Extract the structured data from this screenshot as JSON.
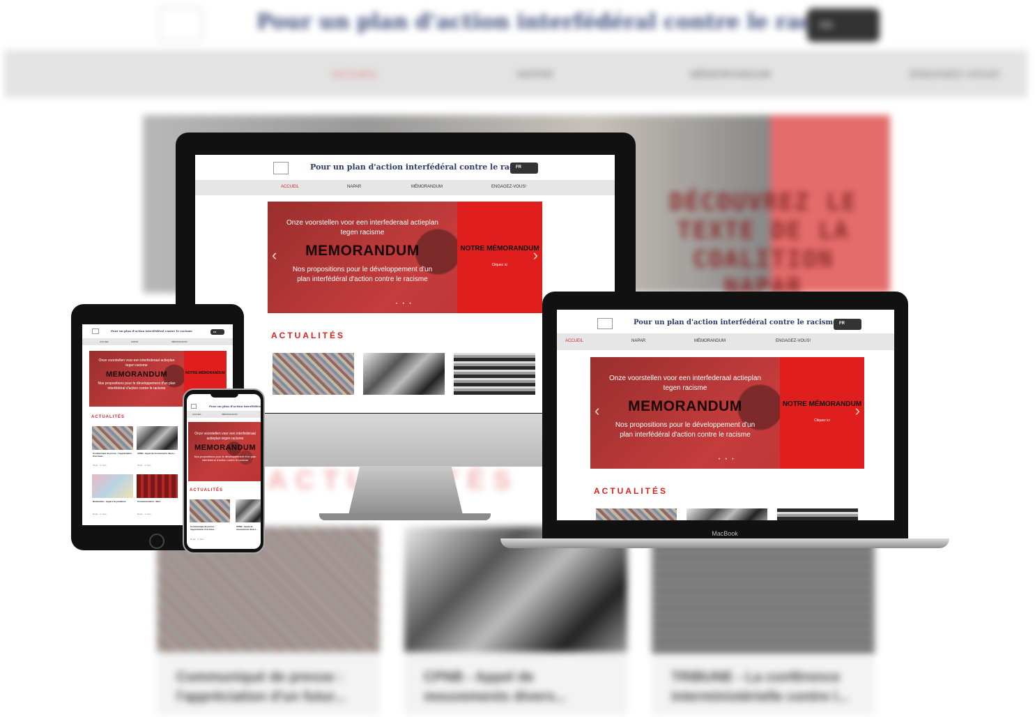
{
  "site": {
    "title": "Pour un plan d'action interfédéral contre le racisme",
    "lang": "FR",
    "nav": [
      "ACCUEIL",
      "NAPAR",
      "MÉMORANDUM",
      "ENGAGEZ-VOUS!"
    ],
    "slide": {
      "intro": "Onze voorstellen voor een interfederaal actieplan tegen racisme",
      "headline": "MEMORANDUM",
      "subtext": "Nos propositions pour le développement d'un plan interfédéral d'action contre le racisme",
      "cta_title": "NOTRE MÉMORANDUM",
      "cta_link": "Cliquez ici",
      "dots": "• • •"
    },
    "news_heading": "ACTUALITÉS",
    "articles": [
      {
        "title": "Communiqué de presse : l'appréciation d'un futur...",
        "meta": "Régis · 6 mars"
      },
      {
        "title": "CPNB - Appel de mouvements divers...",
        "meta": "Régis · 4 mars"
      },
      {
        "title": "Déclaration - Appel à la prudence",
        "meta": "Régis · 2 mars"
      },
      {
        "title": "Commémoration - Mars",
        "meta": "Régis · 1 mars"
      }
    ]
  },
  "background": {
    "title": "Pour un plan d'action interfédéral contre le racisme",
    "lang": "FR",
    "nav": [
      "ACCUEIL",
      "NAPAR",
      "MÉMORANDUM",
      "ENGAGEZ-VOUS!"
    ],
    "slide_text": "DÉCOUVREZ LE TEXTE DE LA COALITION NAPAR",
    "heading": "ACTUALITÉS",
    "cards": [
      "Communiqué de presse : l'appréciation d'un futur...",
      "CPNB - Appel de mouvements divers...",
      "TRIBUNE - La conférence interministérielle contre l..."
    ]
  },
  "devices": {
    "macbook_label": "MacBook",
    "apple_icon": "apple-logo-icon"
  },
  "colors": {
    "accent": "#d72222",
    "title": "#2c3a6b",
    "nav_bg": "#e6e6e6"
  }
}
